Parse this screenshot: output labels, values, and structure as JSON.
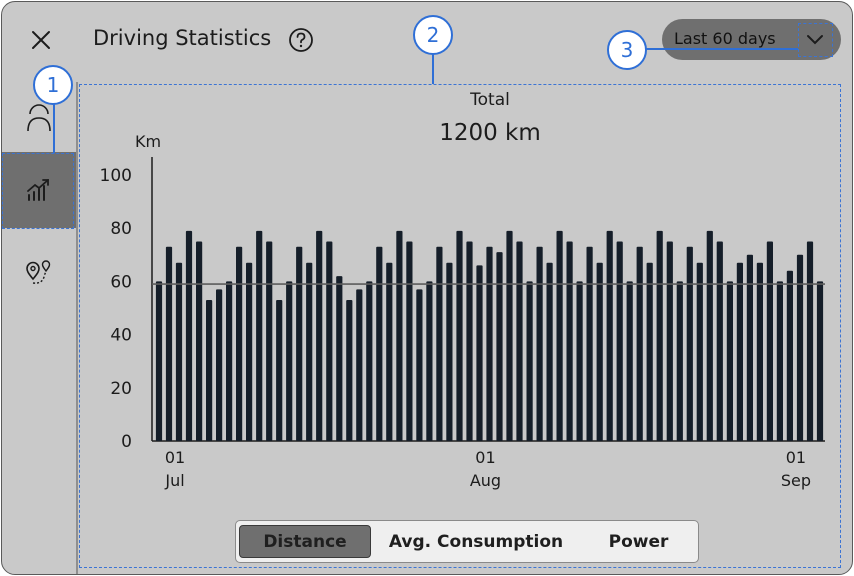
{
  "header": {
    "title": "Driving Statistics",
    "range_label": "Last 60 days"
  },
  "sidebar": {
    "items": [
      {
        "icon": "person-icon",
        "active": false
      },
      {
        "icon": "trend-chart-icon",
        "active": true
      },
      {
        "icon": "route-pins-icon",
        "active": false
      }
    ]
  },
  "summary": {
    "label": "Total",
    "value": "1200 km"
  },
  "segments": {
    "distance": "Distance",
    "consumption": "Avg. Consumption",
    "power": "Power",
    "selected": "Distance"
  },
  "callouts": [
    "1",
    "2",
    "3"
  ],
  "colors": {
    "bar": "#151e29",
    "panel": "#c9c9c9",
    "selected": "#6f6f6f",
    "callout": "#2f6fd6"
  },
  "chart_data": {
    "type": "bar",
    "ylabel": "Km",
    "ylim": [
      0,
      100
    ],
    "yticks": [
      0,
      20,
      40,
      60,
      80,
      100
    ],
    "reference_line": 59,
    "xticks": [
      {
        "index": 0,
        "day": "01",
        "month": "Jul"
      },
      {
        "index": 31,
        "day": "01",
        "month": "Aug"
      },
      {
        "index": 62,
        "day": "01",
        "month": "Sep"
      }
    ],
    "values": [
      60,
      73,
      67,
      79,
      75,
      53,
      57,
      60,
      73,
      67,
      79,
      75,
      53,
      60,
      73,
      67,
      79,
      75,
      62,
      53,
      57,
      60,
      73,
      67,
      79,
      75,
      57,
      60,
      73,
      67,
      79,
      75,
      66,
      73,
      71,
      79,
      75,
      60,
      73,
      67,
      79,
      75,
      60,
      73,
      67,
      79,
      75,
      60,
      73,
      67,
      79,
      75,
      60,
      73,
      67,
      79,
      75,
      60,
      67,
      70,
      67,
      75,
      60,
      64,
      70,
      75,
      60
    ]
  }
}
